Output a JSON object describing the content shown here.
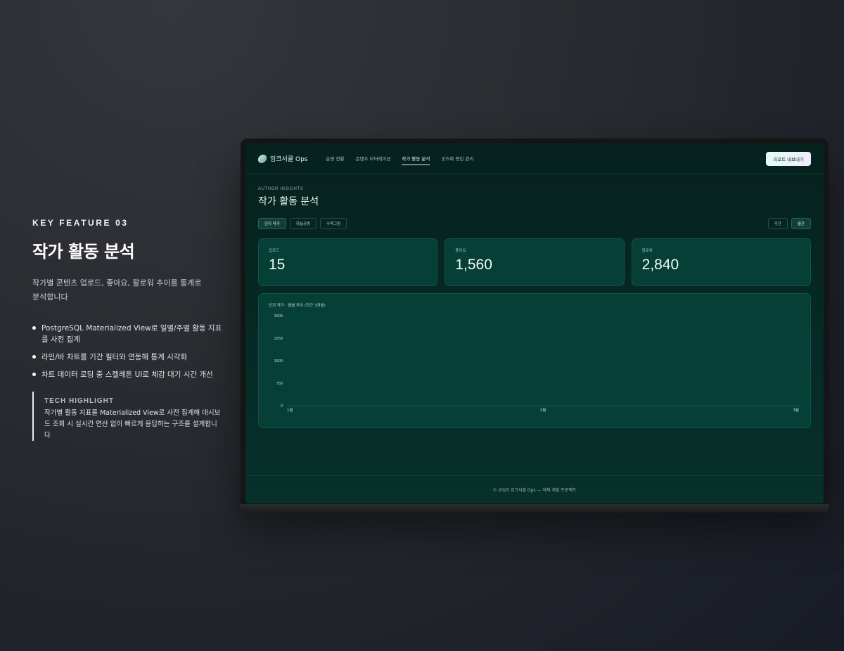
{
  "feature": {
    "kicker": "KEY FEATURE 03",
    "title": "작가 활동 분석",
    "description": "작가별 콘텐츠 업로드, 좋아요, 팔로워 추이를 통계로 분석합니다",
    "bullets": [
      "PostgreSQL Materialized View로 일별/주별 활동 지표를 사전 집계",
      "라인/바 차트를 기간 필터와 연동해 통계 시각화",
      "차트 데이터 로딩 중 스켈레톤 UI로 체감 대기 시간 개선"
    ],
    "tech_title": "TECH HIGHLIGHT",
    "tech_text": "작가별 활동 지표를 Materialized View로 사전 집계해 대시보드 조회 시 실시간 연산 없이 빠르게 응답하는 구조를 설계합니다"
  },
  "app": {
    "brand": "잉크서클 Ops",
    "nav": [
      "운영 현황",
      "콘텐츠 모더레이션",
      "작가 활동 분석",
      "굿즈화 랭킹 관리"
    ],
    "active_nav": "작가 활동 분석",
    "export_label": "리포트 내보내기",
    "eyebrow": "AUTHOR INSIGHTS",
    "page_title": "작가 활동 분석",
    "author_chips": [
      "인지 작가",
      "하늘공방",
      "수묵그림"
    ],
    "selected_author": "인지 작가",
    "period_chips": [
      "주간",
      "월간"
    ],
    "selected_period": "월간",
    "stats": [
      {
        "label": "업로드",
        "value": "15"
      },
      {
        "label": "좋아요",
        "value": "1,560"
      },
      {
        "label": "팔로워",
        "value": "2,840"
      }
    ],
    "footer": "© 2025 잉크서클 Ops — 자체 개발 프로젝트"
  },
  "chart_data": {
    "type": "line",
    "title": "인지 작가 · 월별 추이 (최근 3개월)",
    "categories": [
      "1월",
      "2월",
      "3월"
    ],
    "y_ticks": [
      3000,
      2250,
      1500,
      750,
      0
    ],
    "ylim": [
      0,
      3000
    ],
    "grid": false,
    "colors": {
      "line": "#0f6a5a",
      "tick": "#c9dcd6"
    }
  }
}
